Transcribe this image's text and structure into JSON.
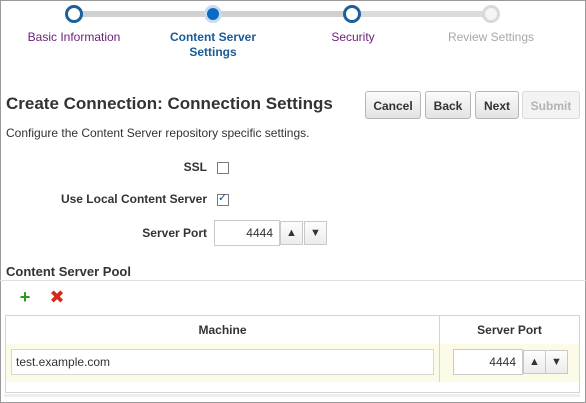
{
  "train": {
    "steps": [
      {
        "label": "Basic Information",
        "state": "visited"
      },
      {
        "label": "Content Server\nSettings",
        "state": "current"
      },
      {
        "label": "Security",
        "state": "visited"
      },
      {
        "label": "Review Settings",
        "state": "disabled"
      }
    ]
  },
  "page": {
    "title": "Create Connection: Connection Settings",
    "description": "Configure the Content Server repository specific settings."
  },
  "buttons": {
    "cancel": "Cancel",
    "back": "Back",
    "next": "Next",
    "submit": "Submit"
  },
  "form": {
    "ssl_label": "SSL",
    "ssl_checked": false,
    "use_local_label": "Use Local Content Server",
    "use_local_checked": true,
    "server_port_label": "Server Port",
    "server_port_value": "4444"
  },
  "pool": {
    "title": "Content Server Pool",
    "columns": [
      "Machine",
      "Server Port"
    ],
    "rows": [
      {
        "machine": "test.example.com",
        "port": "4444"
      }
    ]
  },
  "colors": {
    "link_purple": "#6b1f7a",
    "current_blue": "#0b6bc4",
    "add_green": "#2c9a1c",
    "delete_red": "#d42a1a"
  },
  "icons": {
    "up": "chevron-up-icon",
    "down": "chevron-down-icon",
    "add": "add-icon",
    "delete": "delete-icon",
    "check": "checkmark-icon"
  }
}
